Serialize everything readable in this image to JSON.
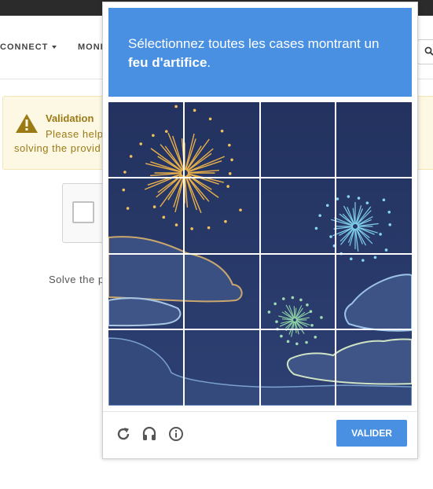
{
  "nav": {
    "item1": "CONNECT",
    "item2": "MONI"
  },
  "alert": {
    "title": "Validation",
    "line1": "Please help",
    "line2": "solving the provid"
  },
  "page": {
    "solve_text": "Solve the p"
  },
  "captcha": {
    "prompt_prefix": "Sélectionnez toutes les cases montrant un ",
    "prompt_bold": "feu d'artifice",
    "prompt_suffix": ".",
    "verify_label": "VALIDER",
    "accent_color": "#4a90e2",
    "grid": {
      "rows": 4,
      "cols": 4
    },
    "footer_icons": [
      "reload-icon",
      "audio-icon",
      "info-icon"
    ]
  },
  "colors": {
    "alert_text": "#9b7a16",
    "night_sky": "#253666",
    "topbar": "#2b2b2b"
  }
}
